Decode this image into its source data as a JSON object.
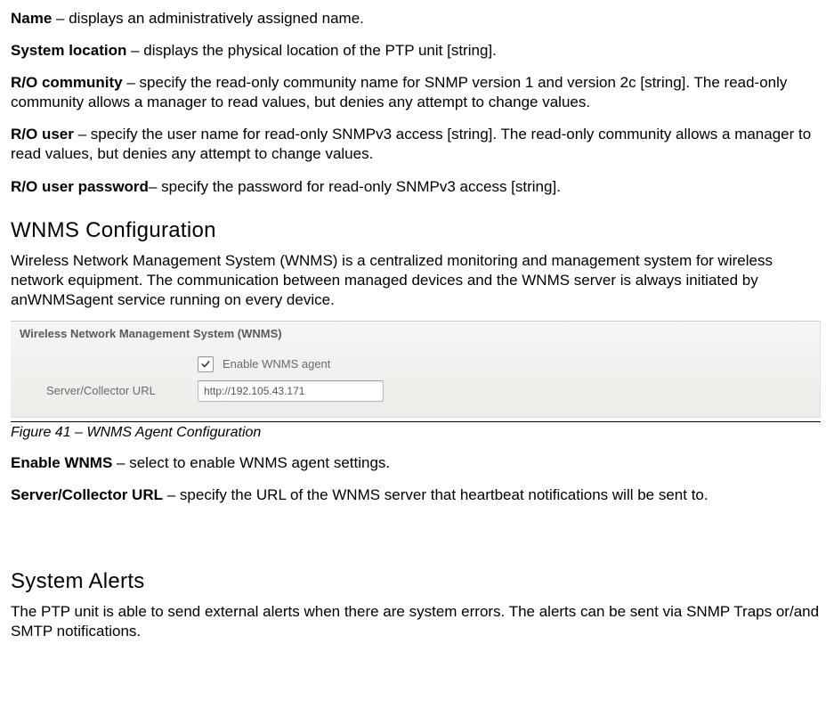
{
  "defs": [
    {
      "term": "Name",
      "sep": " – ",
      "desc": "displays an administratively assigned name."
    },
    {
      "term": "System location",
      "sep": " – ",
      "desc": "displays the physical location of the PTP unit [string]."
    },
    {
      "term": "R/O community",
      "sep": " – ",
      "desc": "specify the read-only community name for SNMP version 1 and version 2c [string]. The read-only community allows a manager to read values, but denies any attempt to change values."
    },
    {
      "term": "R/O user",
      "sep": " – ",
      "desc": "specify the user name for read-only SNMPv3 access [string]. The read-only community allows a manager to read values, but denies any attempt to change values."
    },
    {
      "term": "R/O user password",
      "sep": "– ",
      "desc": "specify the password for read-only SNMPv3 access [string]."
    }
  ],
  "wnms": {
    "heading": "WNMS Configuration",
    "intro": "Wireless Network Management System (WNMS) is a centralized monitoring and management system for wireless network equipment. The communication between managed devices and the WNMS server is always initiated by anWNMSagent service running on every device.",
    "panel_title": "Wireless Network Management System (WNMS)",
    "enable_label": "Enable WNMS agent",
    "url_label": "Server/Collector URL",
    "url_value": "http://192.105.43.171",
    "caption": "Figure 41 – WNMS Agent Configuration",
    "defs": [
      {
        "term": "Enable WNMS",
        "sep": " – ",
        "desc": "select to enable WNMS agent settings."
      },
      {
        "term": "Server/Collector URL",
        "sep": " – ",
        "desc": "specify the URL of the WNMS server that heartbeat notifications will be sent to."
      }
    ]
  },
  "alerts": {
    "heading": "System Alerts",
    "intro": "The PTP unit is able to send external alerts when there are system errors. The alerts can be sent via SNMP Traps or/and SMTP notifications."
  }
}
